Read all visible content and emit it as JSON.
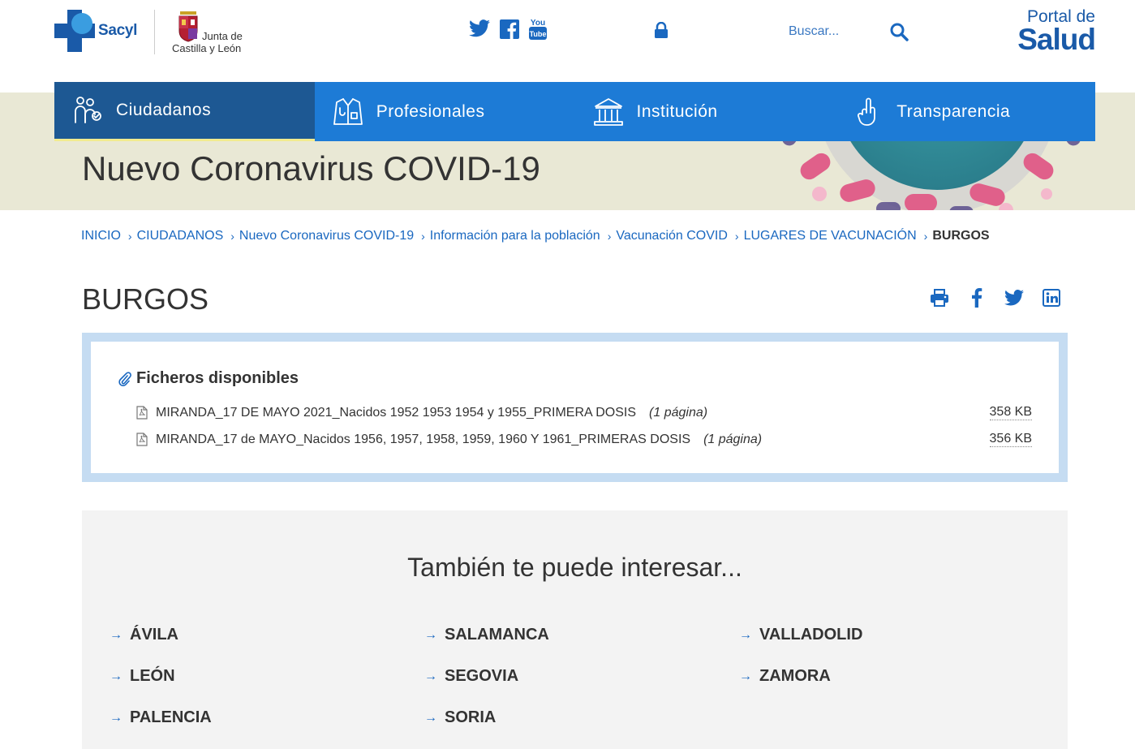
{
  "header": {
    "sacyl_text": "Sacyl",
    "junta_line1": "Junta de",
    "junta_line2": "Castilla y León",
    "search_placeholder": "Buscar...",
    "portal_line1": "Portal de",
    "portal_line2": "Salud",
    "social_icons": [
      "twitter-icon",
      "facebook-icon",
      "youtube-icon"
    ]
  },
  "nav": {
    "items": [
      {
        "label": "Ciudadanos",
        "icon": "people-icon",
        "active": true
      },
      {
        "label": "Profesionales",
        "icon": "doctor-coat-icon",
        "active": false
      },
      {
        "label": "Institución",
        "icon": "institution-icon",
        "active": false
      },
      {
        "label": "Transparencia",
        "icon": "hand-icon",
        "active": false
      }
    ],
    "active_color": "#1d5893",
    "bar_color": "#1d7bd6",
    "active_underline": "#f2eb8f"
  },
  "banner": {
    "title": "Nuevo Coronavirus COVID-19",
    "background": "#e9e8d5"
  },
  "breadcrumb": {
    "items": [
      "INICIO",
      "CIUDADANOS",
      "Nuevo Coronavirus COVID-19",
      "Información para la población",
      "Vacunación COVID",
      "LUGARES DE VACUNACIÓN"
    ],
    "current": "BURGOS"
  },
  "page": {
    "title": "BURGOS",
    "share_icons": [
      "print-icon",
      "facebook-icon",
      "twitter-icon",
      "linkedin-icon"
    ]
  },
  "files": {
    "title": "Ficheros disponibles",
    "items": [
      {
        "name": "MIRANDA_17 DE MAYO 2021_Nacidos 1952 1953 1954 y 1955_PRIMERA DOSIS",
        "pages": "(1 página)",
        "size": "358 KB"
      },
      {
        "name": "MIRANDA_17 de MAYO_Nacidos 1956, 1957, 1958, 1959, 1960 Y 1961_PRIMERAS DOSIS",
        "pages": "(1 página)",
        "size": "356 KB"
      }
    ]
  },
  "related": {
    "title": "También te puede interesar...",
    "items": [
      "ÁVILA",
      "SALAMANCA",
      "VALLADOLID",
      "LEÓN",
      "SEGOVIA",
      "ZAMORA",
      "PALENCIA",
      "SORIA"
    ]
  }
}
